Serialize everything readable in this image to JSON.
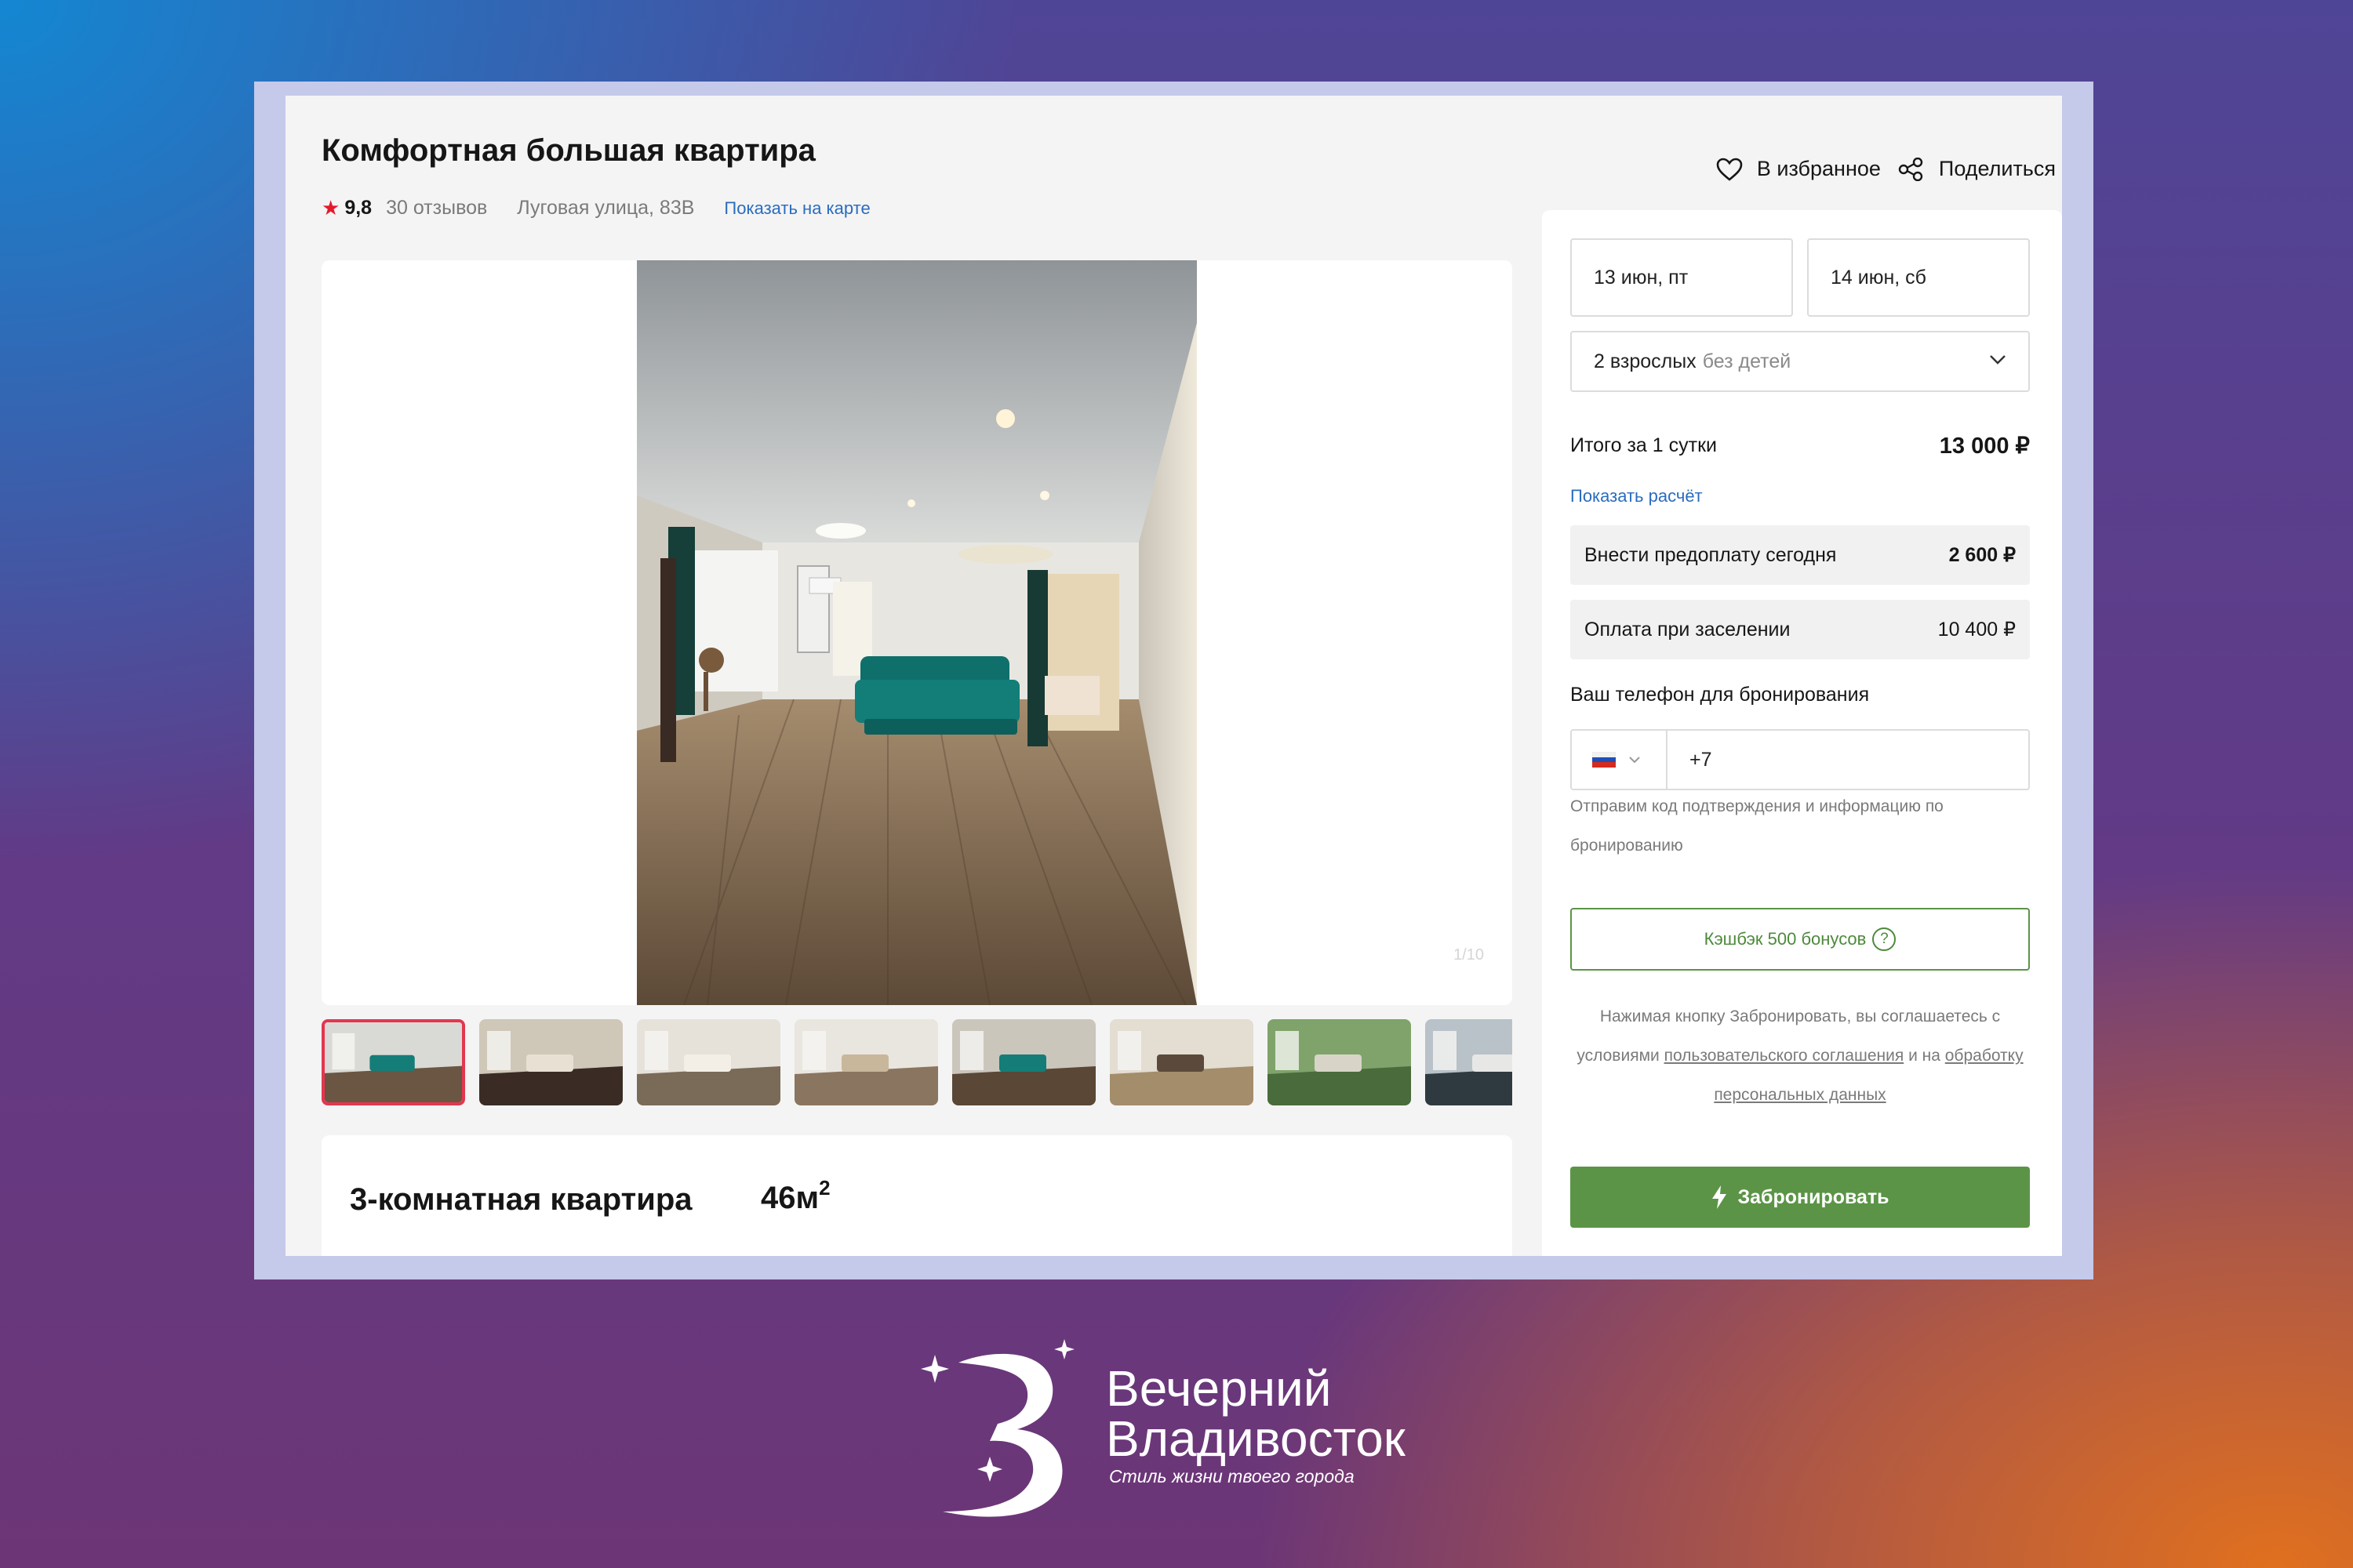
{
  "listing": {
    "title": "Комфортная большая квартира",
    "rating": "9,8",
    "reviews": "30 отзывов",
    "address": "Луговая улица, 83В",
    "map_link": "Показать на карте"
  },
  "actions": {
    "favorite": "В избранное",
    "share": "Поделиться"
  },
  "gallery": {
    "counter": "1/10",
    "thumbnail_count": 8
  },
  "details": {
    "rooms": "3-комнатная квартира",
    "area": "46м",
    "area_sup": "2"
  },
  "booking": {
    "checkin": "13 июн, пт",
    "checkout": "14 июн, сб",
    "guests": "2 взрослых",
    "children": "без детей",
    "total_label": "Итого за 1 сутки",
    "total_value": "13 000 ₽",
    "show_calc": "Показать расчёт",
    "prepay_label": "Внести предоплату сегодня",
    "prepay_value": "2 600 ₽",
    "oncheckin_label": "Оплата при заселении",
    "oncheckin_value": "10 400 ₽",
    "phone_label": "Ваш телефон для бронирования",
    "phone_code": "+7",
    "phone_hint": "Отправим код подтверждения и информацию по бронированию",
    "cashback": "Кэшбэк 500 бонусов",
    "cashback_help": "?",
    "agree_prefix": "Нажимая кнопку Забронировать, вы соглашаетесь с условиями",
    "agree_link1": "пользовательского соглашения",
    "agree_mid": "и на",
    "agree_link2": "обработку персональных данных",
    "book_button": "Забронировать"
  },
  "brand": {
    "line1": "Вечерний",
    "line2": "Владивосток",
    "tagline": "Стиль жизни твоего города"
  },
  "colors": {
    "accent_green": "#5c9447",
    "link_blue": "#2a6cbf",
    "star_red": "#e5192c",
    "active_thumb": "#e3374f"
  }
}
